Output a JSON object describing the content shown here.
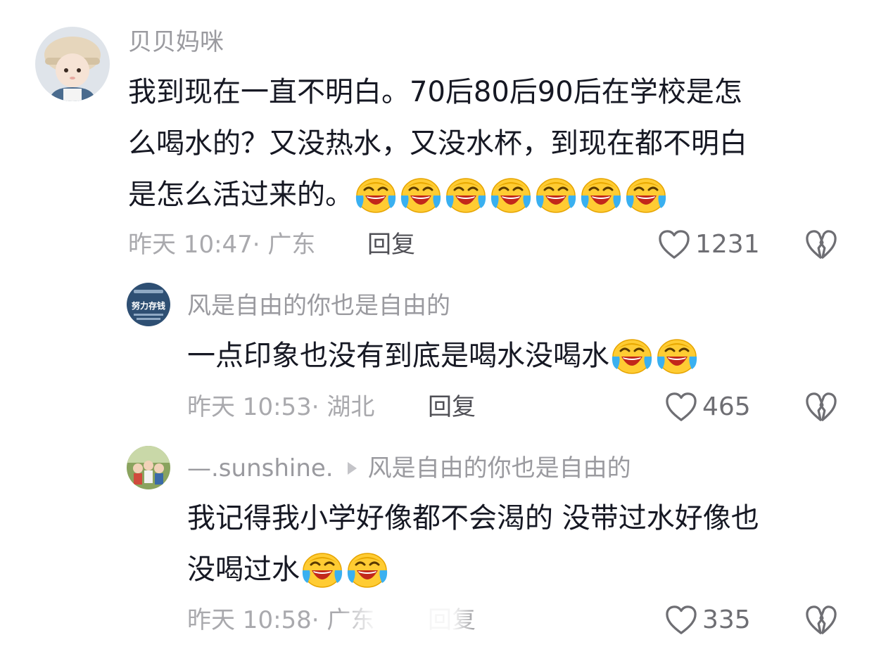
{
  "icons": {
    "emoji": "laugh-cry-emoji",
    "like": "heart-outline-icon",
    "dislike": "broken-heart-icon",
    "reply_arrow": "reply-arrow-icon"
  },
  "colors": {
    "username": "#9a9a9f",
    "meta": "#a9a9ad",
    "reply": "#4f4f55",
    "text": "#161823"
  },
  "comments": [
    {
      "username": "贝贝妈咪",
      "lines": [
        "我到现在一直不明白。70后80后90后在学校是怎",
        "么喝水的？又没热水，又没水杯，到现在都不明白",
        "是怎么活过来的。"
      ],
      "emoji_count": 7,
      "time_location": "昨天 10:47· 广东",
      "reply_label": "回复",
      "likes": "1231"
    },
    {
      "username": "风是自由的你也是自由的",
      "avatar_text": "努力存钱",
      "lines": [
        "一点印象也没有到底是喝水没喝水"
      ],
      "emoji_count": 2,
      "time_location": "昨天 10:53· 湖北",
      "reply_label": "回复",
      "likes": "465"
    },
    {
      "username": "—.sunshine.",
      "reply_to": "风是自由的你也是自由的",
      "lines": [
        "我记得我小学好像都不会渴的 没带过水好像也",
        "没喝过水"
      ],
      "emoji_count": 2,
      "time_location": "昨天 10:58· 广东",
      "reply_label": "回复",
      "likes": "335"
    }
  ]
}
